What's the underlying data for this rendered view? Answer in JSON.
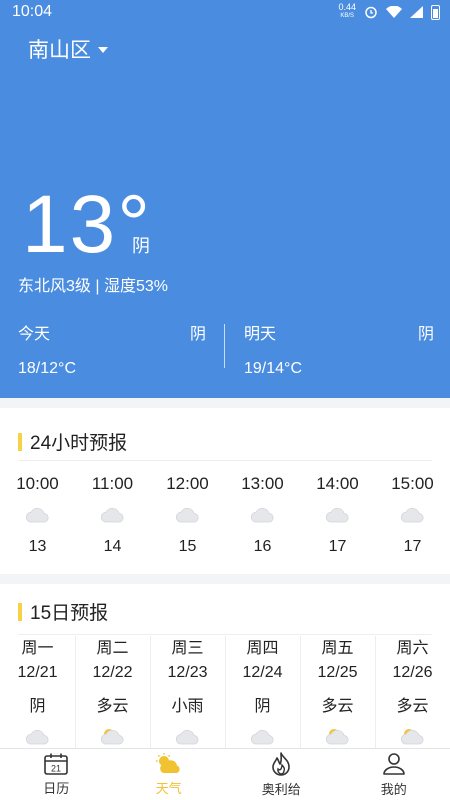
{
  "status": {
    "time": "10:04",
    "net_speed": "0.44",
    "net_unit": "KB/S"
  },
  "location": "南山区",
  "current": {
    "temperature": "13°",
    "condition": "阴",
    "details": "东北风3级 | 湿度53%"
  },
  "today": {
    "label": "今天",
    "condition": "阴",
    "range": "18/12°C"
  },
  "tomorrow": {
    "label": "明天",
    "condition": "阴",
    "range": "19/14°C"
  },
  "hourly": {
    "title": "24小时预报",
    "items": [
      {
        "time": "10:00",
        "temp": "13",
        "icon": "cloud-icon"
      },
      {
        "time": "11:00",
        "temp": "14",
        "icon": "cloud-icon"
      },
      {
        "time": "12:00",
        "temp": "15",
        "icon": "cloud-icon"
      },
      {
        "time": "13:00",
        "temp": "16",
        "icon": "cloud-icon"
      },
      {
        "time": "14:00",
        "temp": "17",
        "icon": "cloud-icon"
      },
      {
        "time": "15:00",
        "temp": "17",
        "icon": "cloud-icon"
      }
    ]
  },
  "daily": {
    "title": "15日预报",
    "items": [
      {
        "weekday": "周一",
        "date": "12/21",
        "condition": "阴",
        "icon": "cloud-icon"
      },
      {
        "weekday": "周二",
        "date": "12/22",
        "condition": "多云",
        "icon": "partly-cloudy-icon"
      },
      {
        "weekday": "周三",
        "date": "12/23",
        "condition": "小雨",
        "icon": "cloud-icon"
      },
      {
        "weekday": "周四",
        "date": "12/24",
        "condition": "阴",
        "icon": "cloud-icon"
      },
      {
        "weekday": "周五",
        "date": "12/25",
        "condition": "多云",
        "icon": "partly-cloudy-icon"
      },
      {
        "weekday": "周六",
        "date": "12/26",
        "condition": "多云",
        "icon": "partly-cloudy-icon"
      }
    ]
  },
  "tabs": [
    {
      "label": "日历",
      "icon": "calendar-icon",
      "calendar_day": "21",
      "active": false
    },
    {
      "label": "天气",
      "icon": "weather-icon",
      "active": true
    },
    {
      "label": "奥利给",
      "icon": "flame-icon",
      "active": false
    },
    {
      "label": "我的",
      "icon": "user-icon",
      "active": false
    }
  ],
  "colors": {
    "header_bg": "#4a8de0",
    "accent": "#f1c232",
    "title_bar": "#f7d247"
  }
}
